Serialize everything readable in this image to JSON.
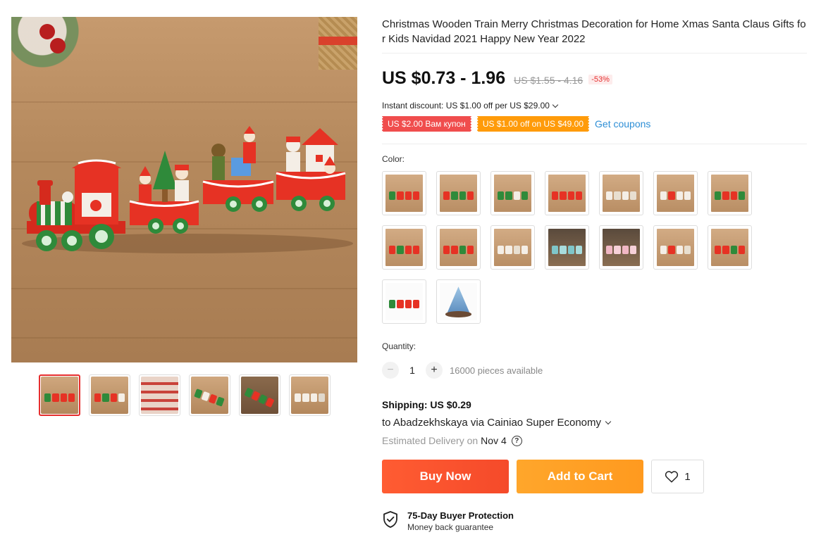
{
  "product": {
    "title": "Christmas Wooden Train Merry Christmas Decoration for Home Xmas Santa Claus Gifts for Kids Navidad 2021 Happy New Year 2022",
    "price": "US $0.73 - 1.96",
    "original_price": "US $1.55 - 4.16",
    "discount_badge": "-53%",
    "instant_discount": "Instant discount: US $1.00 off per US $29.00",
    "coupons": [
      {
        "label": "US $2.00 Вам купон",
        "color": "#f04d4d"
      },
      {
        "label": "US $1.00 off on US $49.00",
        "color": "#ff9b0a"
      }
    ],
    "get_coupons_label": "Get coupons"
  },
  "gallery": {
    "thumbnails": [
      "thumb-1",
      "thumb-2",
      "thumb-3",
      "thumb-4",
      "thumb-5",
      "thumb-6"
    ],
    "active_index": 0
  },
  "color": {
    "label": "Color:",
    "swatch_count": 16
  },
  "quantity": {
    "label": "Quantity:",
    "value": "1",
    "minus_icon": "−",
    "plus_icon": "+",
    "available": "16000 pieces available"
  },
  "shipping": {
    "title": "Shipping: US $0.29",
    "destination": "to Abadzekhskaya via Cainiao Super Economy",
    "eta_label": "Estimated Delivery on",
    "eta_date": "Nov 4",
    "help_icon": "?"
  },
  "actions": {
    "buy_now": "Buy Now",
    "add_to_cart": "Add to Cart",
    "wishlist_count": "1"
  },
  "protection": {
    "title": "75-Day Buyer Protection",
    "subtitle": "Money back guarantee"
  },
  "colors": {
    "accent_red": "#e62e2e",
    "buy_now": "#f54a2a",
    "add_to_cart": "#ff9a1f",
    "link_blue": "#2e8fd6"
  }
}
